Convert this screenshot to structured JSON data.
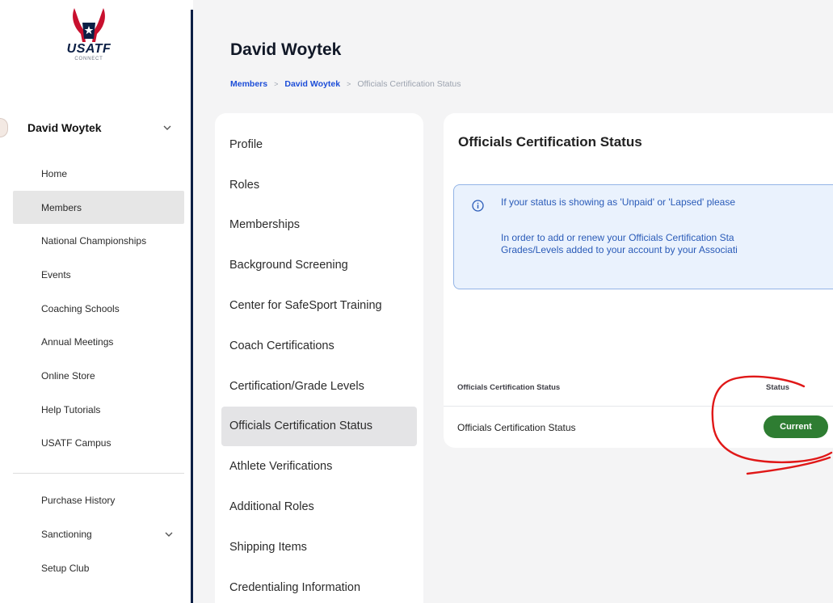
{
  "logo": {
    "wordmark": "USATF",
    "subtext": "CONNECT",
    "colors": {
      "navy": "#0b1f45",
      "red": "#c8102e"
    }
  },
  "user": {
    "name": "David Woytek"
  },
  "sidebar": {
    "items": [
      {
        "label": "Home",
        "active": false
      },
      {
        "label": "Members",
        "active": true
      },
      {
        "label": "National Championships",
        "active": false
      },
      {
        "label": "Events",
        "active": false
      },
      {
        "label": "Coaching Schools",
        "active": false
      },
      {
        "label": "Annual Meetings",
        "active": false
      },
      {
        "label": "Online Store",
        "active": false
      },
      {
        "label": "Help Tutorials",
        "active": false
      },
      {
        "label": "USATF Campus",
        "active": false
      }
    ],
    "secondary_items": [
      {
        "label": "Purchase History",
        "has_chevron": false
      },
      {
        "label": "Sanctioning",
        "has_chevron": true
      },
      {
        "label": "Setup Club",
        "has_chevron": false
      }
    ]
  },
  "header": {
    "title": "David Woytek",
    "breadcrumb": [
      "Members",
      "David Woytek",
      "Officials Certification Status"
    ]
  },
  "subnav": {
    "items": [
      {
        "label": "Profile",
        "active": false
      },
      {
        "label": "Roles",
        "active": false
      },
      {
        "label": "Memberships",
        "active": false
      },
      {
        "label": "Background Screening",
        "active": false
      },
      {
        "label": "Center for SafeSport Training",
        "active": false
      },
      {
        "label": "Coach Certifications",
        "active": false
      },
      {
        "label": "Certification/Grade Levels",
        "active": false
      },
      {
        "label": "Officials Certification Status",
        "active": true
      },
      {
        "label": "Athlete Verifications",
        "active": false
      },
      {
        "label": "Additional Roles",
        "active": false
      },
      {
        "label": "Shipping Items",
        "active": false
      },
      {
        "label": "Credentialing Information",
        "active": false
      }
    ]
  },
  "card": {
    "title": "Officials Certification Status",
    "alert": {
      "icon": "info-icon",
      "line1": "If your status is showing as 'Unpaid' or 'Lapsed' please",
      "line2": "In order to add or renew your Officials Certification Sta",
      "line3": "Grades/Levels added to your account by your Associati"
    },
    "table": {
      "headers": [
        "Officials Certification Status",
        "Status"
      ],
      "rows": [
        {
          "name": "Officials Certification Status",
          "status": "Current"
        }
      ]
    },
    "badge_color": "#2e7d32"
  },
  "annotation": {
    "color": "#e01818",
    "shape": "hand-drawn circle around status badge"
  }
}
